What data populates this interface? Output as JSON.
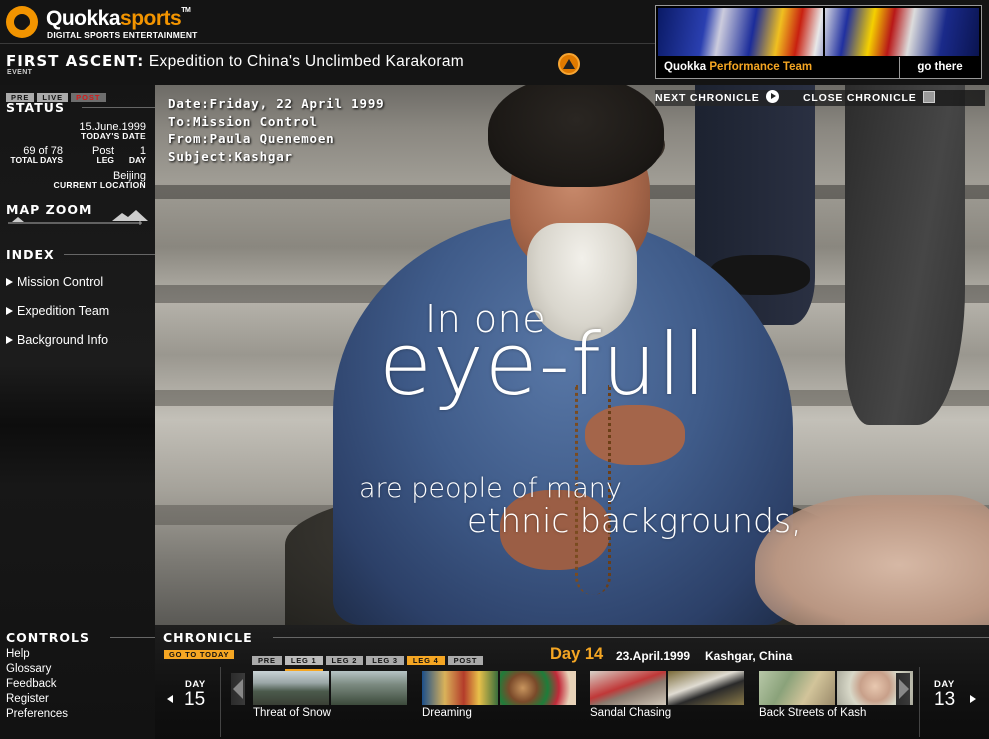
{
  "header": {
    "logo_name_1": "Quokka",
    "logo_name_2": "sports",
    "logo_tm": "TM",
    "logo_tagline": "DIGITAL SPORTS ENTERTAINMENT",
    "event_prefix": "FIRST ASCENT:",
    "event_title": "Expedition to China's Unclimbed Karakoram",
    "event_label": "EVENT",
    "performance_team_1": "Quokka",
    "performance_team_2": "Performance Team",
    "go_there": "go there"
  },
  "status": {
    "phase_tabs": [
      "PRE",
      "LIVE",
      "POST"
    ],
    "active_phase": "POST",
    "title": "STATUS",
    "date_value": "15.June.1999",
    "date_label": "TODAY'S DATE",
    "total_days_value": "69 of 78",
    "total_days_label": "TOTAL DAYS",
    "leg_value": "Post",
    "leg_label": "LEG",
    "day_value": "1",
    "day_label": "DAY",
    "location_value": "Beijing",
    "location_label": "CURRENT LOCATION"
  },
  "map_zoom": {
    "title": "MAP ZOOM"
  },
  "index": {
    "title": "INDEX",
    "items": [
      "Mission Control",
      "Expedition Team",
      "Background Info"
    ]
  },
  "controls": {
    "title": "CONTROLS",
    "items": [
      "Help",
      "Glossary",
      "Feedback",
      "Register",
      "Preferences"
    ]
  },
  "memo": {
    "date": "Date:Friday, 22 April 1999",
    "to": "To:Mission Control",
    "from": "From:Paula Quenemoen",
    "subject": "Subject:Kashgar"
  },
  "chronicle_nav": {
    "next": "NEXT CHRONICLE",
    "close": "CLOSE CHRONICLE"
  },
  "overlay": {
    "line1": "In one",
    "line2": "eye-full",
    "line3": "are people of many",
    "line4": "ethnic backgrounds,"
  },
  "chronicle": {
    "title": "CHRONICLE",
    "goto_today": "GO TO TODAY",
    "leg_tabs": [
      "PRE",
      "LEG 1",
      "LEG 2",
      "LEG 3",
      "LEG 4",
      "POST"
    ],
    "selected_leg": "LEG 1",
    "highlight_leg": "LEG 4",
    "current_day": "Day 14",
    "current_date": "23.April.1999",
    "current_location": "Kashgar, China",
    "prev_day_label": "DAY",
    "prev_day_number": "15",
    "next_day_label": "DAY",
    "next_day_number": "13",
    "entries": [
      {
        "label": "Threat of Snow"
      },
      {
        "label": "Dreaming"
      },
      {
        "label": "Sandal Chasing"
      },
      {
        "label": "Back Streets of Kash"
      }
    ]
  },
  "colors": {
    "brand_orange": "#f29400",
    "accent_yellow": "#f5a623",
    "post_red": "#d61a1a",
    "background": "#141414"
  }
}
